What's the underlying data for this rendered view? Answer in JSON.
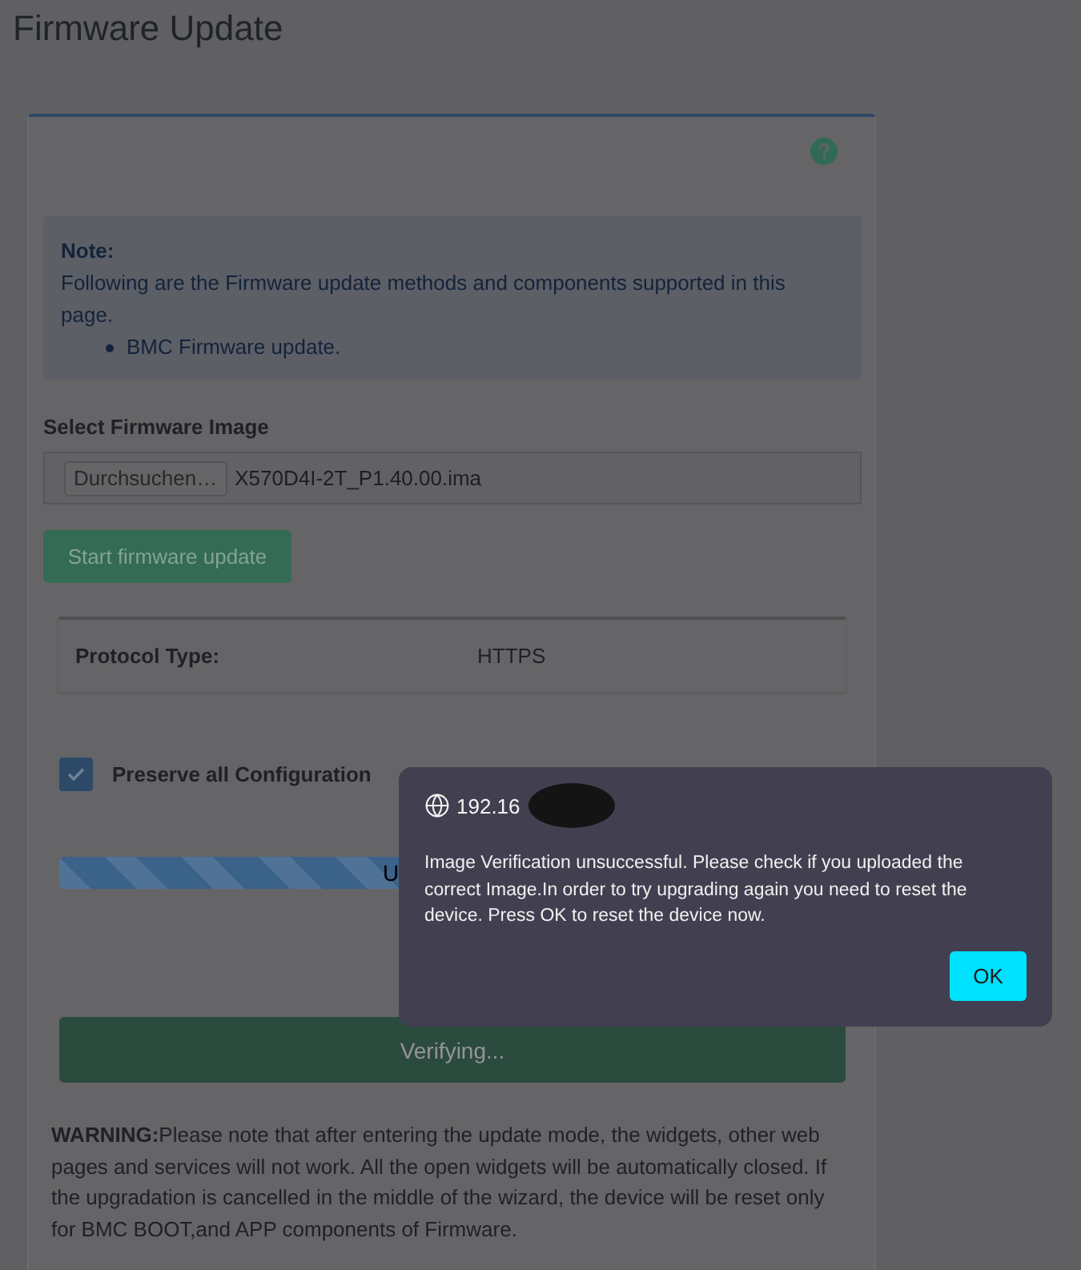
{
  "page": {
    "title": "Firmware Update"
  },
  "note": {
    "heading": "Note:",
    "text": "Following are the Firmware update methods and components supported in this page.",
    "items": [
      "BMC Firmware update."
    ]
  },
  "firmware_image": {
    "label": "Select Firmware Image",
    "browse_button": "Durchsuchen…",
    "file_name": "X570D4I-2T_P1.40.00.ima"
  },
  "start_button": {
    "label": "Start firmware update",
    "disabled": true
  },
  "protocol": {
    "label": "Protocol Type:",
    "value": "HTTPS"
  },
  "preserve_config": {
    "label": "Preserve all Configuration",
    "checked": true
  },
  "progress": {
    "label": "U",
    "level": 1
  },
  "verify_button": {
    "label": "Verifying...",
    "disabled": true
  },
  "warning": {
    "text": "**WARNING:**Please note that after entering the update mode, the widgets, other web pages and services will not work. All the open widgets will be automatically closed. If the upgradation is cancelled in the middle of the wizard, the device will be reset only for BMC BOOT,and APP components of Firmware."
  },
  "dialog": {
    "origin": "192.16",
    "message": "Image Verification unsuccessful. Please check if you uploaded the correct Image.In order to try upgrading again you need to reset the device. Press OK to reset the device now.",
    "buttons": [
      "OK"
    ]
  }
}
